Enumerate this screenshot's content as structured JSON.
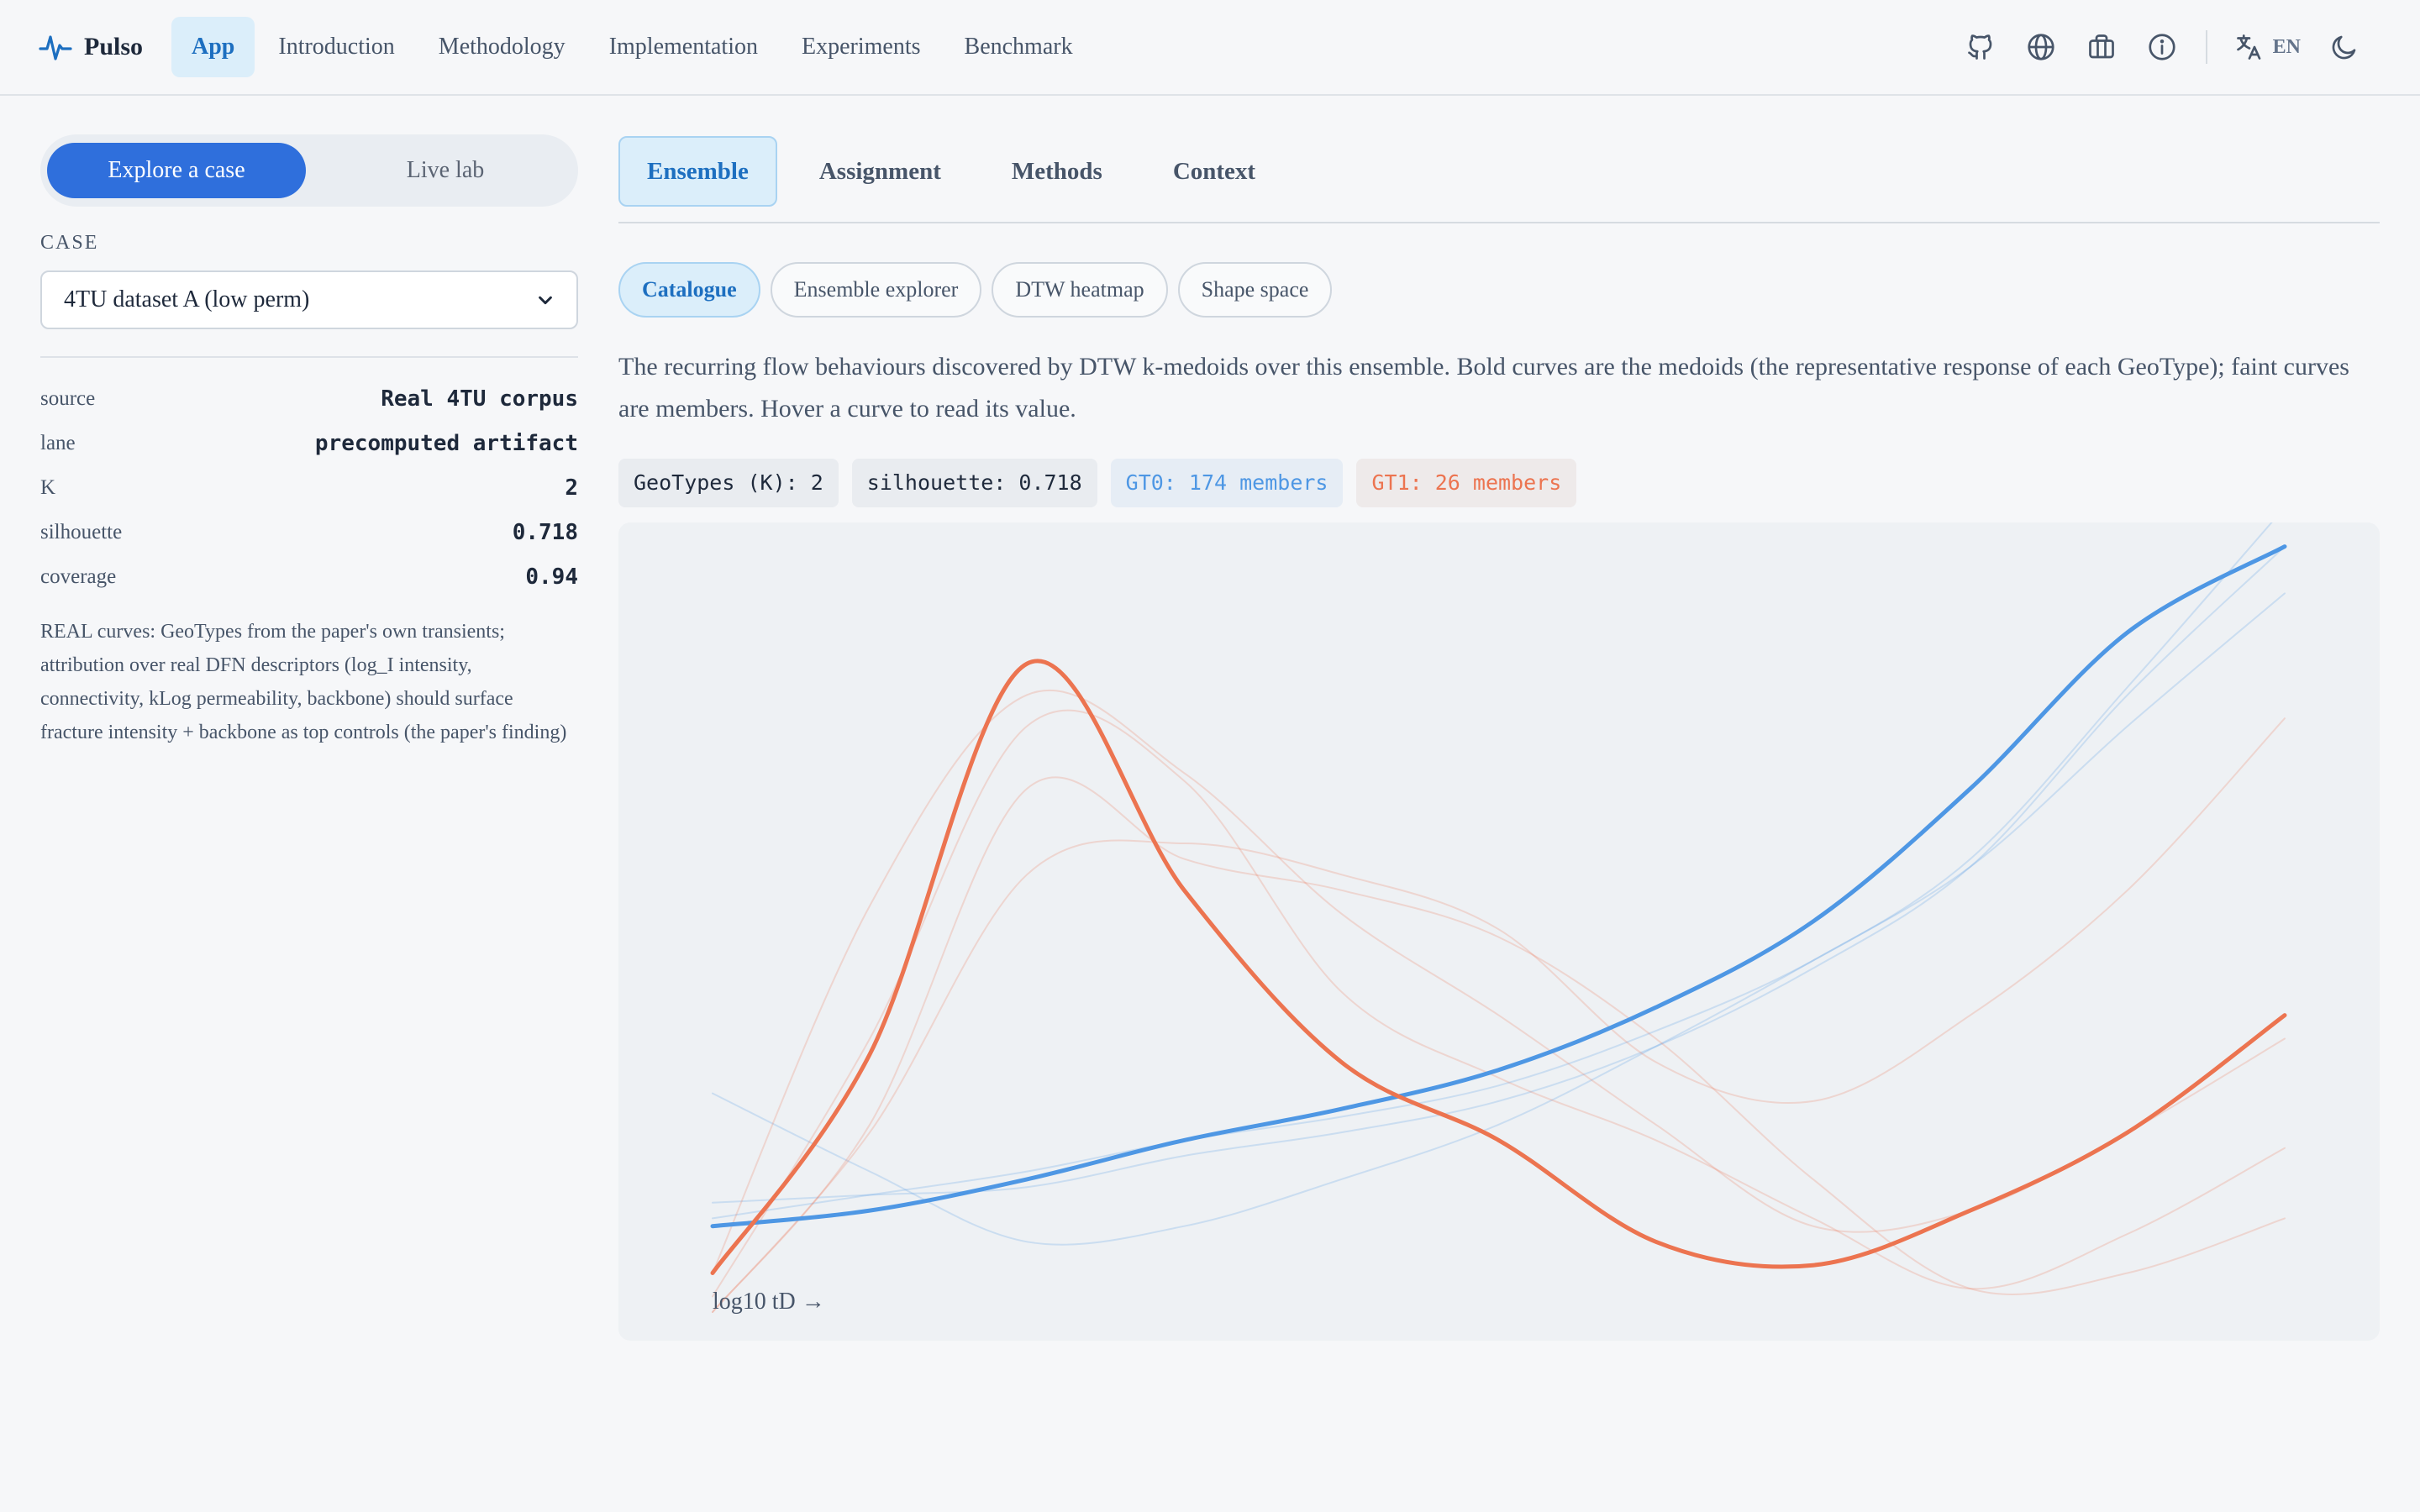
{
  "nav": {
    "brand": "Pulso",
    "links": [
      "App",
      "Introduction",
      "Methodology",
      "Implementation",
      "Experiments",
      "Benchmark"
    ],
    "active": "App",
    "lang": "EN",
    "icons": [
      "github-icon",
      "globe-icon",
      "briefcase-icon",
      "info-icon",
      "translate-icon",
      "moon-icon"
    ]
  },
  "sidebar": {
    "mode": {
      "on": "Explore a case",
      "off": "Live lab"
    },
    "case_label": "CASE",
    "case_value": "4TU dataset A (low perm)",
    "stats": [
      {
        "key": "source",
        "value": "Real 4TU corpus"
      },
      {
        "key": "lane",
        "value": "precomputed artifact"
      },
      {
        "key": "K",
        "value": "2"
      },
      {
        "key": "silhouette",
        "value": "0.718"
      },
      {
        "key": "coverage",
        "value": "0.94"
      }
    ],
    "note": "REAL curves: GeoTypes from the paper's own transients; attribution over real DFN descriptors (log_I intensity, connectivity, kLog permeability, backbone) should surface fracture intensity + backbone as top controls (the paper's finding)"
  },
  "main": {
    "tabs": [
      "Ensemble",
      "Assignment",
      "Methods",
      "Context"
    ],
    "active_tab": "Ensemble",
    "subtabs": [
      "Catalogue",
      "Ensemble explorer",
      "DTW heatmap",
      "Shape space"
    ],
    "active_subtab": "Catalogue",
    "description": "The recurring flow behaviours discovered by DTW k-medoids over this ensemble. Bold curves are the medoids (the representative response of each GeoType); faint curves are members. Hover a curve to read its value.",
    "chips": {
      "k": "GeoTypes (K): 2",
      "silhouette": "silhouette: 0.718",
      "gt0": "GT0: 174 members",
      "gt1": "GT1: 26 members"
    },
    "xaxis_label": "log10 tD →"
  },
  "colors": {
    "gt0": "#4e97e4",
    "gt1": "#ec7450",
    "accent": "#2f6fdc"
  },
  "chart_data": {
    "type": "line",
    "xlabel": "log10 tD →",
    "x": [
      0,
      0.1,
      0.2,
      0.3,
      0.4,
      0.5,
      0.6,
      0.7,
      0.8,
      0.9,
      1.0
    ],
    "medoids": [
      {
        "name": "GT0",
        "values": [
          0.11,
          0.13,
          0.17,
          0.22,
          0.26,
          0.31,
          0.39,
          0.5,
          0.67,
          0.87,
          0.98
        ]
      },
      {
        "name": "GT1",
        "values": [
          0.05,
          0.33,
          0.83,
          0.54,
          0.32,
          0.22,
          0.09,
          0.06,
          0.13,
          0.23,
          0.38
        ]
      }
    ],
    "members": {
      "GT0": [
        [
          0.12,
          0.15,
          0.18,
          0.22,
          0.25,
          0.29,
          0.36,
          0.45,
          0.58,
          0.8,
          1.03
        ],
        [
          0.14,
          0.15,
          0.16,
          0.2,
          0.23,
          0.27,
          0.34,
          0.44,
          0.57,
          0.79,
          0.98
        ],
        [
          0.28,
          0.18,
          0.09,
          0.11,
          0.17,
          0.24,
          0.34,
          0.45,
          0.57,
          0.75,
          0.92
        ]
      ],
      "GT1": [
        [
          0.05,
          0.52,
          0.79,
          0.69,
          0.51,
          0.38,
          0.24,
          0.11,
          0.13,
          0.23,
          0.35
        ],
        [
          0.02,
          0.35,
          0.75,
          0.68,
          0.41,
          0.3,
          0.22,
          0.12,
          0.03,
          0.1,
          0.21
        ],
        [
          0.0,
          0.24,
          0.67,
          0.58,
          0.54,
          0.48,
          0.35,
          0.17,
          0.03,
          0.05,
          0.12
        ],
        [
          0.0,
          0.23,
          0.56,
          0.6,
          0.56,
          0.49,
          0.32,
          0.27,
          0.38,
          0.54,
          0.76
        ]
      ]
    }
  }
}
